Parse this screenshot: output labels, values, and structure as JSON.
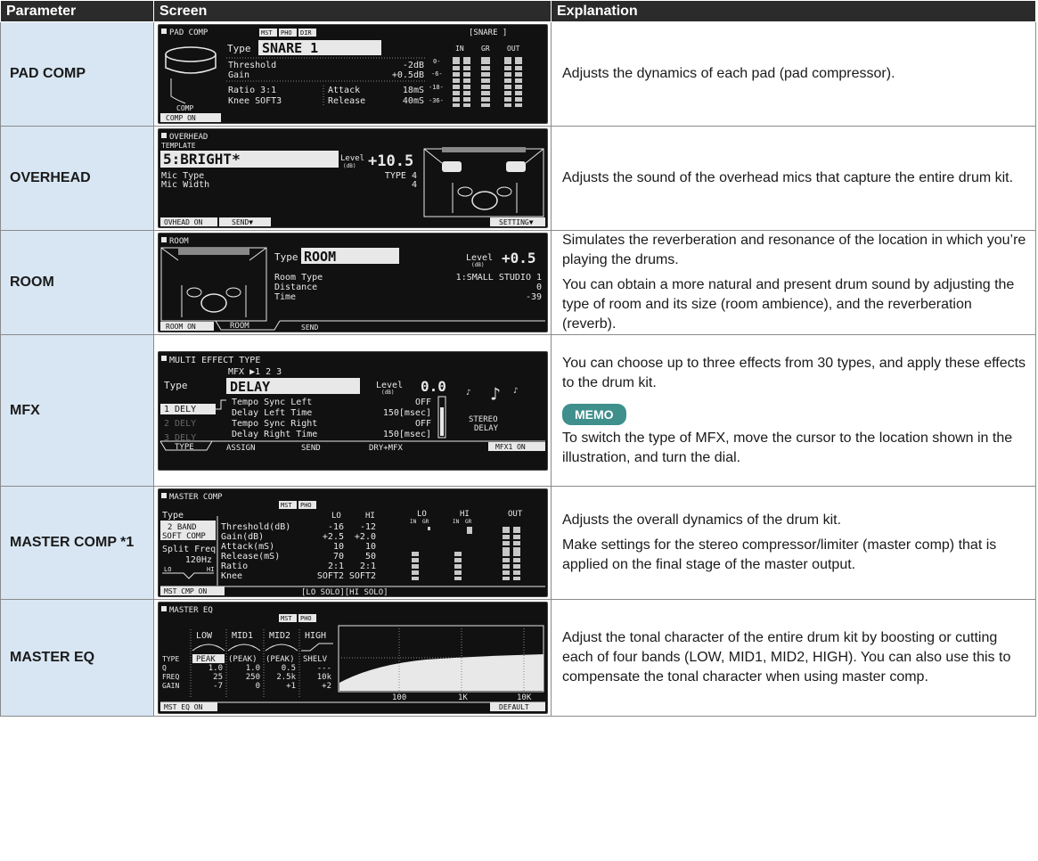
{
  "header": {
    "col1": "Parameter",
    "col2": "Screen",
    "col3": "Explanation"
  },
  "rows": [
    {
      "param": "PAD COMP",
      "lcd": {
        "title": "PAD COMP",
        "badges": [
          "MST",
          "PHO",
          "DIR"
        ],
        "pad": "[SNARE ]",
        "type_label": "Type",
        "type_value": "SNARE 1",
        "lines": [
          [
            "Threshold",
            "-2dB"
          ],
          [
            "Gain",
            "+0.5dB"
          ]
        ],
        "ratio": "Ratio   3:1",
        "attack": "Attack",
        "attack_val": "18mS",
        "knee": "Knee SOFT3",
        "release": "Release",
        "release_val": "40mS",
        "meters": [
          "IN",
          "GR",
          "OUT"
        ],
        "scale": [
          "0-",
          "-6-",
          "-18-",
          "-36-"
        ],
        "graph_label": "COMP",
        "tabs": [
          "COMP ON"
        ]
      },
      "text": [
        "Adjusts the dynamics of each pad (pad compressor)."
      ]
    },
    {
      "param": "OVERHEAD",
      "lcd": {
        "title": "OVERHEAD",
        "subtitle": "TEMPLATE",
        "type_value": "5:BRIGHT*",
        "level_label": "Level",
        "level_unit": "(dB)",
        "level_value": "+10.5",
        "lines": [
          [
            "Mic Type",
            "TYPE 4"
          ],
          [
            "Mic Width",
            "4"
          ]
        ],
        "tabs": [
          "OVHEAD ON",
          "SEND▼",
          "SETTING▼"
        ]
      },
      "text": [
        "Adjusts the sound of the overhead mics that capture the entire drum kit."
      ]
    },
    {
      "param": "ROOM",
      "lcd": {
        "title": "ROOM",
        "type_label": "Type",
        "type_value": "ROOM",
        "level_label": "Level",
        "level_unit": "(dB)",
        "level_value": "+0.5",
        "lines": [
          [
            "Room Type",
            "1:SMALL STUDIO 1"
          ],
          [
            "Distance",
            "0"
          ],
          [
            "Time",
            "-39"
          ]
        ],
        "tabs": [
          "ROOM ON",
          "ROOM",
          "SEND"
        ]
      },
      "text": [
        "Simulates the reverberation and resonance of the location in which you’re playing the drums.",
        "You can obtain a more natural and present drum sound by adjusting the type of room and its size (room ambience), and the reverberation (reverb)."
      ]
    },
    {
      "param": "MFX",
      "lcd": {
        "title": "MULTI EFFECT TYPE",
        "mfx_sel": "MFX ▶1 2 3",
        "type_label": "Type",
        "type_value": "DELAY",
        "level_label": "Level",
        "level_unit": "(dB)",
        "level_value": "0.0",
        "slots": [
          "1 DELY",
          "2 DELY",
          "3 DELY"
        ],
        "lines": [
          [
            "Tempo Sync Left",
            "OFF"
          ],
          [
            "Delay Left Time",
            "150[msec]"
          ],
          [
            "Tempo Sync Right",
            "OFF"
          ],
          [
            "Delay Right Time",
            "150[msec]"
          ]
        ],
        "effect_name": [
          "STEREO",
          "DELAY"
        ],
        "tabs": [
          "TYPE",
          "ASSIGN",
          "SEND",
          "DRY+MFX",
          "MFX1 ON"
        ]
      },
      "memo": "MEMO",
      "text": [
        "You can choose up to three effects from 30 types, and apply these effects to the drum kit.",
        "To switch the type of MFX, move the cursor to the location shown in the illustration, and turn the dial."
      ]
    },
    {
      "param": "MASTER COMP *1",
      "lcd": {
        "title": "MASTER COMP",
        "badges": [
          "MST",
          "PHO"
        ],
        "type_label": "Type",
        "type_value": [
          "2 BAND",
          "SOFT COMP"
        ],
        "split_label": "Split Freq",
        "split_value": "120Hz",
        "col_heads": [
          "LO",
          "HI"
        ],
        "lines": [
          [
            "Threshold(dB)",
            "-16",
            "-12"
          ],
          [
            "Gain(dB)",
            "+2.5",
            "+2.0"
          ],
          [
            "Attack(mS)",
            "10",
            "10"
          ],
          [
            "Release(mS)",
            "70",
            "50"
          ],
          [
            "Ratio",
            "2:1",
            "2:1"
          ],
          [
            "Knee",
            "SOFT2",
            "SOFT2"
          ]
        ],
        "meters": [
          "LO",
          "HI",
          "OUT"
        ],
        "meter_sub": [
          "IN",
          "GR",
          "IN",
          "GR"
        ],
        "tabs": [
          "MST CMP ON",
          "[LO SOLO][HI SOLO]"
        ]
      },
      "text": [
        "Adjusts the overall dynamics of the drum kit.",
        "Make settings for the stereo compressor/limiter (master comp) that is applied on the final stage of the master output."
      ]
    },
    {
      "param": "MASTER EQ",
      "lcd": {
        "title": "MASTER EQ",
        "badges": [
          "MST",
          "PHO"
        ],
        "bands": [
          "LOW",
          "MID1",
          "MID2",
          "HIGH"
        ],
        "row_labels": [
          "TYPE",
          "Q",
          "FREQ",
          "GAIN"
        ],
        "type_row": [
          "PEAK",
          "(PEAK)",
          "(PEAK)",
          "SHELV"
        ],
        "q_row": [
          "1.0",
          "1.0",
          "0.5",
          "---"
        ],
        "freq_row": [
          "25",
          "250",
          "2.5k",
          "10k"
        ],
        "gain_row": [
          "-7",
          "0",
          "+1",
          "+2"
        ],
        "axis": [
          "100",
          "1K",
          "10K"
        ],
        "tabs": [
          "MST EQ ON",
          "DEFAULT"
        ]
      },
      "text": [
        "Adjust the tonal character of the entire drum kit by boosting or cutting each of four bands (LOW, MID1, MID2, HIGH). You can also use this to compensate the tonal character when using master comp."
      ]
    }
  ]
}
